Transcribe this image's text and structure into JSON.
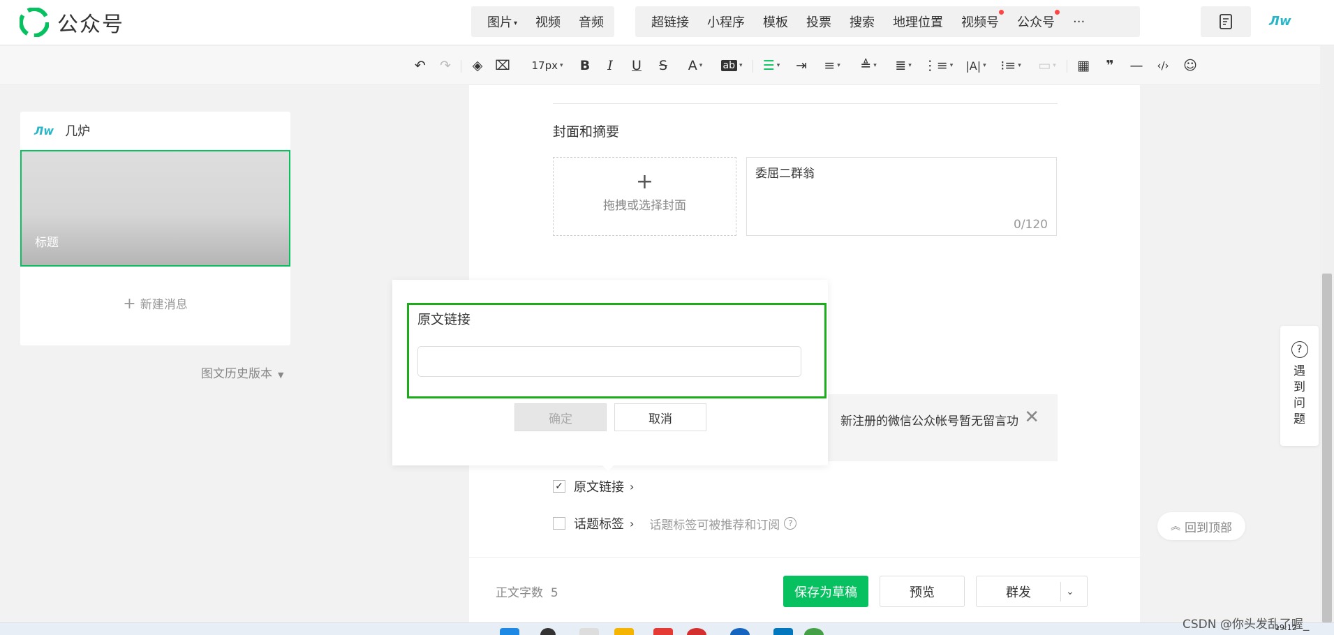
{
  "header": {
    "app_name": "公众号",
    "nav_group1": [
      {
        "label": "图片",
        "has_caret": true
      },
      {
        "label": "视频"
      },
      {
        "label": "音频"
      }
    ],
    "nav_group2": [
      {
        "label": "超链接"
      },
      {
        "label": "小程序"
      },
      {
        "label": "模板"
      },
      {
        "label": "投票"
      },
      {
        "label": "搜索"
      },
      {
        "label": "地理位置"
      },
      {
        "label": "视频号",
        "red_dot": true
      },
      {
        "label": "公众号",
        "red_dot": true
      },
      {
        "label": "···"
      }
    ],
    "brand_color": "#07c160",
    "account_logo_text": "Лw"
  },
  "toolbar": {
    "font_size": "17px",
    "icons": [
      "undo-icon",
      "redo-icon",
      "format-painter-icon",
      "clear-format-icon",
      "font-size-select",
      "bold-icon",
      "italic-icon",
      "underline-icon",
      "strikethrough-icon",
      "font-color-icon",
      "background-color-icon",
      "align-icon",
      "indent-icon",
      "paragraph-spacing-icon",
      "line-height-icon",
      "letter-spacing-icon",
      "list-indent-icon",
      "text-direction-icon",
      "bullet-list-icon",
      "disabled-format-icon",
      "table-icon",
      "quote-icon",
      "divider-icon",
      "code-icon",
      "emoji-icon"
    ],
    "active_color": "#07c160"
  },
  "left_panel": {
    "account_logo": "Лw",
    "account_name": "几炉",
    "article_title": "标题",
    "new_message": "新建消息",
    "history_label": "图文历史版本"
  },
  "main": {
    "section_title": "封面和摘要",
    "cover_label": "拖拽或选择封面",
    "summary_text": "委屈二群翁",
    "summary_count": "0/120",
    "notice_text": "新注册的微信公众帐号暂无留言功",
    "options": [
      {
        "label": "原文链接",
        "checked": true,
        "hint": ""
      },
      {
        "label": "话题标签",
        "checked": false,
        "hint": "话题标签可被推荐和订阅"
      }
    ]
  },
  "popover": {
    "label": "原文链接",
    "input_value": "",
    "ok_label": "确定",
    "cancel_label": "取消"
  },
  "bottom_bar": {
    "word_count_label": "正文字数",
    "word_count": "5",
    "save_label": "保存为草稿",
    "preview_label": "预览",
    "send_label": "群发"
  },
  "right": {
    "help_text": "遇到问题",
    "back_top_label": "回到顶部"
  },
  "taskbar": {
    "clock": "19:12",
    "watermark": "CSDN @你头发乱了喔_"
  }
}
